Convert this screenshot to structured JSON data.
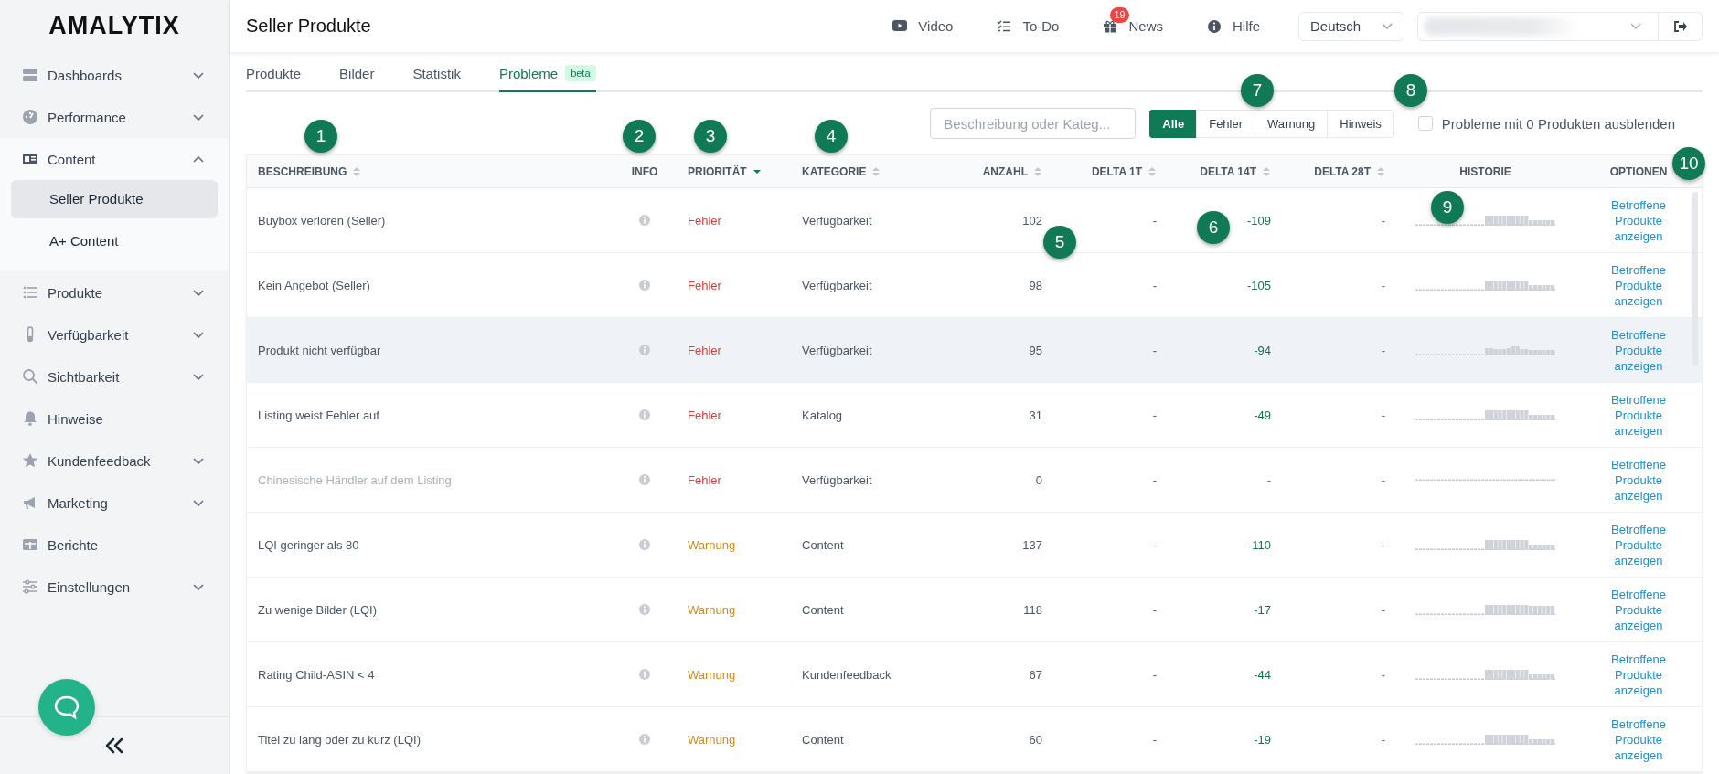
{
  "sidebar": {
    "logo": "AMALYTIX",
    "items": [
      {
        "label": "Dashboards",
        "expandable": true,
        "expanded": false,
        "selected": false
      },
      {
        "label": "Performance",
        "expandable": true,
        "expanded": false,
        "selected": false
      },
      {
        "label": "Content",
        "expandable": true,
        "expanded": true,
        "selected": false,
        "children": [
          {
            "label": "Seller Produkte",
            "selected": true
          },
          {
            "label": "A+ Content",
            "selected": false
          }
        ]
      },
      {
        "label": "Produkte",
        "expandable": true,
        "expanded": false,
        "selected": false
      },
      {
        "label": "Verfügbarkeit",
        "expandable": true,
        "expanded": false,
        "selected": false
      },
      {
        "label": "Sichtbarkeit",
        "expandable": true,
        "expanded": false,
        "selected": false
      },
      {
        "label": "Hinweise",
        "expandable": false,
        "selected": false
      },
      {
        "label": "Kundenfeedback",
        "expandable": true,
        "expanded": false,
        "selected": false
      },
      {
        "label": "Marketing",
        "expandable": true,
        "expanded": false,
        "selected": false
      },
      {
        "label": "Berichte",
        "expandable": false,
        "selected": false
      },
      {
        "label": "Einstellungen",
        "expandable": true,
        "expanded": false,
        "selected": false
      }
    ]
  },
  "header": {
    "title": "Seller Produkte",
    "links": [
      {
        "label": "Video"
      },
      {
        "label": "To-Do"
      },
      {
        "label": "News",
        "badge": "19"
      },
      {
        "label": "Hilfe"
      }
    ],
    "language": "Deutsch"
  },
  "tabs": [
    {
      "label": "Produkte",
      "selected": false
    },
    {
      "label": "Bilder",
      "selected": false
    },
    {
      "label": "Statistik",
      "selected": false
    },
    {
      "label": "Probleme",
      "selected": true,
      "badge": "beta"
    }
  ],
  "toolbar": {
    "search": {
      "placeholder": "Beschreibung oder Kateg..."
    },
    "filters": [
      {
        "label": "Alle",
        "selected": true
      },
      {
        "label": "Fehler",
        "selected": false
      },
      {
        "label": "Warnung",
        "selected": false
      },
      {
        "label": "Hinweis",
        "selected": false
      }
    ],
    "hide_empty": {
      "label": "Probleme mit 0 Produkten ausblenden",
      "checked": false
    }
  },
  "table": {
    "columns": [
      {
        "label": "BESCHREIBUNG",
        "sortable": true,
        "sorted": false
      },
      {
        "label": "INFO",
        "sortable": false
      },
      {
        "label": "PRIORITÄT",
        "sortable": true,
        "sorted": true
      },
      {
        "label": "KATEGORIE",
        "sortable": true,
        "sorted": false
      },
      {
        "label": "ANZAHL",
        "sortable": true,
        "sorted": false
      },
      {
        "label": "DELTA 1T",
        "sortable": true,
        "sorted": false
      },
      {
        "label": "DELTA 14T",
        "sortable": true,
        "sorted": false
      },
      {
        "label": "DELTA 28T",
        "sortable": true,
        "sorted": false
      },
      {
        "label": "HISTORIE",
        "sortable": false
      },
      {
        "label": "OPTIONEN",
        "sortable": false
      }
    ],
    "rows": [
      {
        "description": "Buybox verloren (Seller)",
        "muted": false,
        "hovered": false,
        "priority": {
          "label": "Fehler",
          "color": "#dc3c3c"
        },
        "category": "Verfügbarkeit",
        "count": "102",
        "delta_1t": "-",
        "delta_14t": "-109",
        "delta_14t_changed": true,
        "delta_28t": "-",
        "history_empty": false,
        "link": "Betroffene Produkte anzeigen"
      },
      {
        "description": "Kein Angebot (Seller)",
        "muted": false,
        "hovered": false,
        "priority": {
          "label": "Fehler",
          "color": "#dc3c3c"
        },
        "category": "Verfügbarkeit",
        "count": "98",
        "delta_1t": "-",
        "delta_14t": "-105",
        "delta_14t_changed": true,
        "delta_28t": "-",
        "history_empty": false,
        "link": "Betroffene Produkte anzeigen"
      },
      {
        "description": "Produkt nicht verfügbar",
        "muted": false,
        "hovered": true,
        "priority": {
          "label": "Fehler",
          "color": "#dc3c3c"
        },
        "category": "Verfügbarkeit",
        "count": "95",
        "delta_1t": "-",
        "delta_14t": "-94",
        "delta_14t_changed": true,
        "delta_28t": "-",
        "history_empty": false,
        "link": "Betroffene Produkte anzeigen"
      },
      {
        "description": "Listing weist Fehler auf",
        "muted": false,
        "hovered": false,
        "priority": {
          "label": "Fehler",
          "color": "#dc3c3c"
        },
        "category": "Katalog",
        "count": "31",
        "delta_1t": "-",
        "delta_14t": "-49",
        "delta_14t_changed": true,
        "delta_28t": "-",
        "history_empty": false,
        "link": "Betroffene Produkte anzeigen"
      },
      {
        "description": "Chinesische Händler auf dem Listing",
        "muted": true,
        "hovered": false,
        "priority": {
          "label": "Fehler",
          "color": "#dc3c3c"
        },
        "category": "Verfügbarkeit",
        "count": "0",
        "delta_1t": "-",
        "delta_14t": "-",
        "delta_14t_changed": false,
        "delta_28t": "-",
        "history_empty": true,
        "link": "Betroffene Produkte anzeigen"
      },
      {
        "description": "LQI geringer als 80",
        "muted": false,
        "hovered": false,
        "priority": {
          "label": "Warnung",
          "color": "#d08a1a"
        },
        "category": "Content",
        "count": "137",
        "delta_1t": "-",
        "delta_14t": "-110",
        "delta_14t_changed": true,
        "delta_28t": "-",
        "history_empty": false,
        "link": "Betroffene Produkte anzeigen"
      },
      {
        "description": "Zu wenige Bilder (LQI)",
        "muted": false,
        "hovered": false,
        "priority": {
          "label": "Warnung",
          "color": "#d08a1a"
        },
        "category": "Content",
        "count": "118",
        "delta_1t": "-",
        "delta_14t": "-17",
        "delta_14t_changed": true,
        "delta_28t": "-",
        "history_empty": false,
        "link": "Betroffene Produkte anzeigen"
      },
      {
        "description": "Rating Child-ASIN < 4",
        "muted": false,
        "hovered": false,
        "priority": {
          "label": "Warnung",
          "color": "#d08a1a"
        },
        "category": "Kundenfeedback",
        "count": "67",
        "delta_1t": "-",
        "delta_14t": "-44",
        "delta_14t_changed": true,
        "delta_28t": "-",
        "history_empty": false,
        "link": "Betroffene Produkte anzeigen"
      },
      {
        "description": "Titel zu lang oder zu kurz (LQI)",
        "muted": false,
        "hovered": false,
        "priority": {
          "label": "Warnung",
          "color": "#d08a1a"
        },
        "category": "Content",
        "count": "60",
        "delta_1t": "-",
        "delta_14t": "-19",
        "delta_14t_changed": true,
        "delta_28t": "-",
        "history_empty": false,
        "link": "Betroffene Produkte anzeigen"
      }
    ]
  },
  "markers": [
    {
      "number": "1"
    },
    {
      "number": "2"
    },
    {
      "number": "3"
    },
    {
      "number": "4"
    },
    {
      "number": "5"
    },
    {
      "number": "6"
    },
    {
      "number": "7"
    },
    {
      "number": "8"
    },
    {
      "number": "9"
    },
    {
      "number": "10"
    }
  ]
}
